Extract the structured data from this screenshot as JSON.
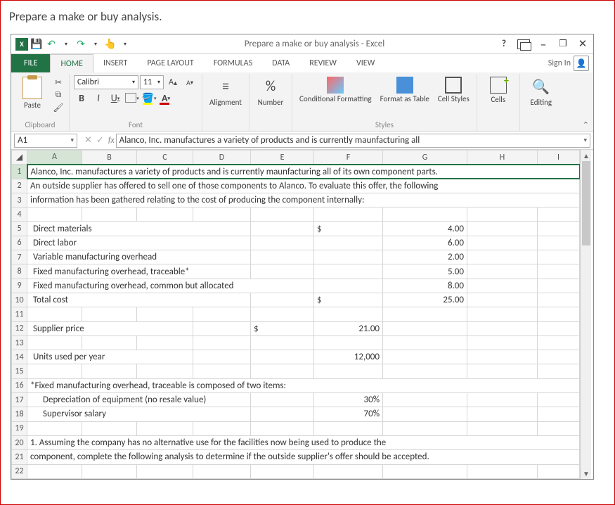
{
  "page": {
    "heading": "Prepare a make or buy analysis."
  },
  "titlebar": {
    "text": "Prepare a make or buy analysis - Excel"
  },
  "signin": {
    "label": "Sign In"
  },
  "tabs": {
    "file": "FILE",
    "home": "HOME",
    "insert": "INSERT",
    "pagelayout": "PAGE LAYOUT",
    "formulas": "FORMULAS",
    "data": "DATA",
    "review": "REVIEW",
    "view": "VIEW"
  },
  "ribbon": {
    "clipboard": {
      "paste": "Paste",
      "label": "Clipboard"
    },
    "font": {
      "name": "Calibri",
      "size": "11",
      "bold": "B",
      "italic": "I",
      "underline": "U",
      "label": "Font"
    },
    "alignment": {
      "btn": "Alignment"
    },
    "number": {
      "btn": "Number",
      "pct": "%"
    },
    "styles": {
      "cond": "Conditional Formatting",
      "fmt": "Format as Table",
      "cell": "Cell Styles",
      "label": "Styles"
    },
    "cells": {
      "btn": "Cells"
    },
    "editing": {
      "btn": "Editing"
    }
  },
  "namebox": "A1",
  "formulabar": "Alanco, Inc. manufactures a variety of products and is currently maunfacturing all",
  "cols": {
    "A": "A",
    "B": "B",
    "C": "C",
    "D": "D",
    "E": "E",
    "F": "F",
    "G": "G",
    "H": "H",
    "I": "I"
  },
  "rows": {
    "r1": "Alanco, Inc. manufactures a variety of products and is currently maunfacturing all of its own component parts.",
    "r2": "An outside supplier has offered to sell one of those components to Alanco.  To evaluate this offer, the following",
    "r3": "information has been gathered relating to the cost of producing the component internally:",
    "r5a": "Direct materials",
    "r5f": "$",
    "r5g": "4.00",
    "r6a": "Direct labor",
    "r6g": "6.00",
    "r7a": "Variable manufacturing overhead",
    "r7g": "2.00",
    "r8a": "Fixed manufacturing overhead, traceable*",
    "r8g": "5.00",
    "r9a": "Fixed manufacturing overhead, common but allocated",
    "r9g": "8.00",
    "r10a": "Total cost",
    "r10f": "$",
    "r10g": "25.00",
    "r12a": "Supplier price",
    "r12e": "$",
    "r12f": "21.00",
    "r14a": "Units used per year",
    "r14f": "12,000",
    "r16": "*Fixed manufacturing overhead, traceable is composed of two items:",
    "r17a": "Depreciation of equipment (no resale value)",
    "r17f": "30%",
    "r18a": "Supervisor salary",
    "r18f": "70%",
    "r20": "1. Assuming the company has no alternative use for the facilities now being used to produce the",
    "r21": "component, complete the following analysis to determine if the outside supplier's offer should be accepted."
  }
}
